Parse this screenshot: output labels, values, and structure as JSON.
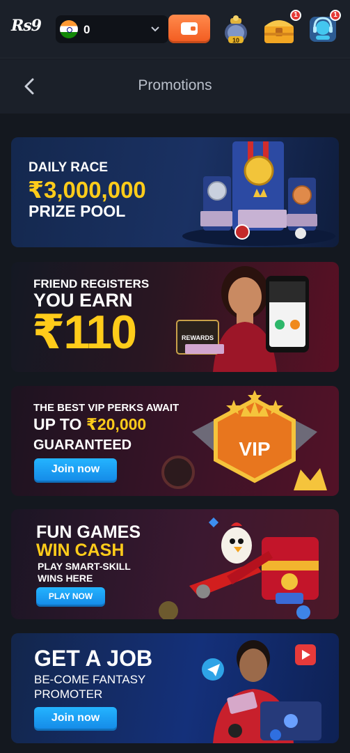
{
  "topbar": {
    "logo": "Rs9",
    "balance": "0",
    "chest_badge": "1",
    "support_badge": "1",
    "jar_label": "10"
  },
  "header": {
    "title": "Promotions"
  },
  "banners": [
    {
      "line1": "DAILY RACE",
      "line2": "₹3,000,000",
      "line3": "PRIZE POOL"
    },
    {
      "line1": "FRIEND REGISTERS",
      "line2": "YOU EARN",
      "line3": "₹110",
      "chest_label": "REWARDS"
    },
    {
      "line1": "THE BEST VIP PERKS AWAIT",
      "line2a": "UP TO ",
      "line2b": "₹20,000",
      "line3": "GUARANTEED",
      "button": "Join now",
      "emblem": "VIP"
    },
    {
      "line1": "FUN GAMES",
      "line2": "WIN CASH",
      "line3": "PLAY SMART-SKILL",
      "line4": "WINS HERE",
      "button": "PLAY NOW"
    },
    {
      "line1": "GET A JOB",
      "line2": "BE-COME FANTASY",
      "line3": "PROMOTER",
      "button": "Join now"
    }
  ],
  "colors": {
    "accent_gold": "#ffcc1a",
    "button_blue": "#1a9cf5",
    "wallet_orange": "#f26a2c",
    "background": "#14181f"
  }
}
